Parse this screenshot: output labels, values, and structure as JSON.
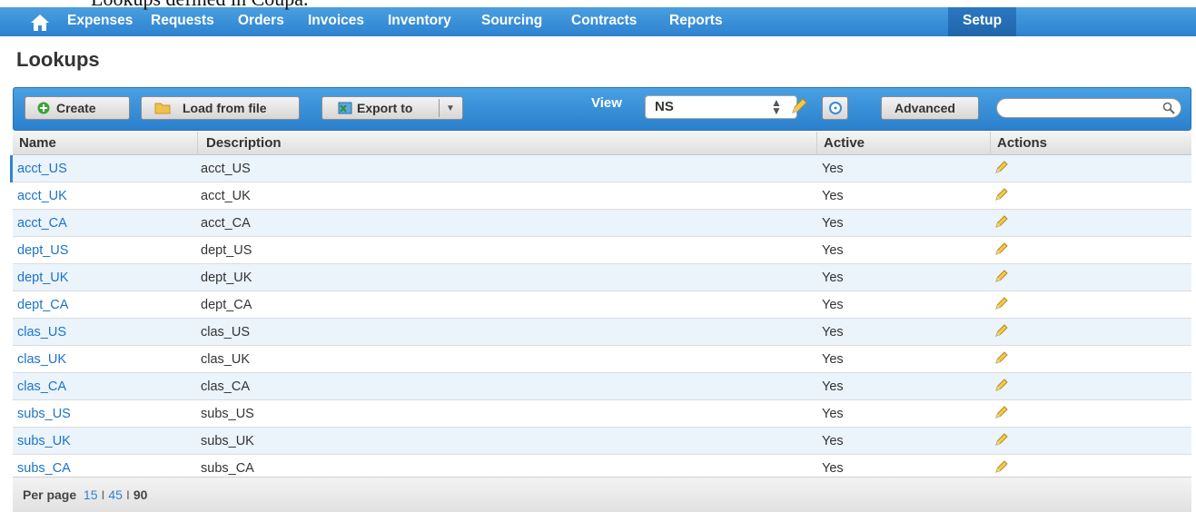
{
  "caption": "Lookups defined in Coupa.",
  "nav": {
    "items": [
      "Expenses",
      "Requests",
      "Orders",
      "Invoices",
      "Inventory",
      "Sourcing",
      "Contracts",
      "Reports",
      "Setup"
    ],
    "active": "Setup"
  },
  "page_title": "Lookups",
  "toolbar": {
    "create": "Create",
    "load_from_file": "Load from file",
    "export_to": "Export to",
    "view_label": "View",
    "view_value": "NS",
    "advanced": "Advanced"
  },
  "table": {
    "headers": [
      "Name",
      "Description",
      "Active",
      "Actions"
    ],
    "rows": [
      {
        "name": "acct_US",
        "description": "acct_US",
        "active": "Yes"
      },
      {
        "name": "acct_UK",
        "description": "acct_UK",
        "active": "Yes"
      },
      {
        "name": "acct_CA",
        "description": "acct_CA",
        "active": "Yes"
      },
      {
        "name": "dept_US",
        "description": "dept_US",
        "active": "Yes"
      },
      {
        "name": "dept_UK",
        "description": "dept_UK",
        "active": "Yes"
      },
      {
        "name": "dept_CA",
        "description": "dept_CA",
        "active": "Yes"
      },
      {
        "name": "clas_US",
        "description": "clas_US",
        "active": "Yes"
      },
      {
        "name": "clas_UK",
        "description": "clas_UK",
        "active": "Yes"
      },
      {
        "name": "clas_CA",
        "description": "clas_CA",
        "active": "Yes"
      },
      {
        "name": "subs_US",
        "description": "subs_US",
        "active": "Yes"
      },
      {
        "name": "subs_UK",
        "description": "subs_UK",
        "active": "Yes"
      },
      {
        "name": "subs_CA",
        "description": "subs_CA",
        "active": "Yes"
      }
    ]
  },
  "footer": {
    "per_page_label": "Per page",
    "options": [
      "15",
      "45",
      "90"
    ],
    "selected": "90"
  },
  "colors": {
    "nav_blue": "#2c82cf",
    "link_blue": "#1a74c8",
    "row_alt": "#ebf3fb"
  },
  "icons": {
    "home": "home-icon",
    "create": "plus-circle-icon",
    "load": "folder-icon",
    "export": "spreadsheet-icon",
    "edit": "pencil-icon",
    "search": "magnifier-icon"
  }
}
